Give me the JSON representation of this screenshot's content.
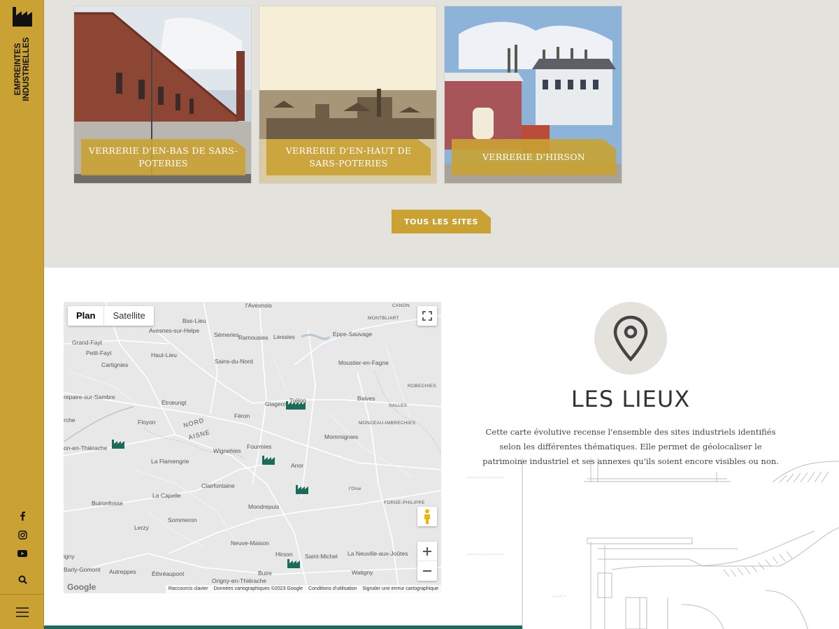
{
  "sidebar": {
    "brand": "EMPREINTES INDUSTRIELLES",
    "social": [
      "facebook-icon",
      "instagram-icon",
      "youtube-icon",
      "search-icon"
    ],
    "menu_icon": "hamburger-icon"
  },
  "cards": [
    {
      "label": "VERRERIE D'EN-BAS DE SARS-POTERIES"
    },
    {
      "label": "VERRERIE D'EN-HAUT DE SARS-POTERIES"
    },
    {
      "label": "VERRERIE D'HIRSON"
    }
  ],
  "all_sites_label": "TOUS LES SITES",
  "map": {
    "tab_plan": "Plan",
    "tab_satellite": "Satellite",
    "footer": {
      "shortcuts": "Raccourcis clavier",
      "data": "Données cartographiques ©2023 Google",
      "terms": "Conditions d'utilisation",
      "report": "Signaler une erreur cartographique"
    },
    "places": [
      "l'Avesnois",
      "CANON",
      "MONTBLIART",
      "Bas-Lieu",
      "Avesnes-sur-Helpe",
      "Sémeries",
      "Ramousies",
      "Liessies",
      "Eppe-Sauvage",
      "Grand-Fayt",
      "Petit-Fayt",
      "Haut-Lieu",
      "Sains-du-Nord",
      "Moustier-en-Fagne",
      "Cartignies",
      "ROBECHIES",
      "repaire-sur-Sambre",
      "Étrœungt",
      "Glageon",
      "Trélon",
      "Baives",
      "SALLES",
      "Féron",
      "MONCEAU-IMBRECHIES",
      "rche",
      "Floyon",
      "NORD",
      "AISNE",
      "Mommignies",
      "on-en-Thiérache",
      "Wignehies",
      "Fourmies",
      "La Flamengrie",
      "Anor",
      "Clairfontaine",
      "La Capelle",
      "l'Oise",
      "FORGE-PHILIPPE",
      "Buironfosse",
      "Mondrepuis",
      "Sommeron",
      "Lerzy",
      "Neuve-Maison",
      "igny",
      "Hirson",
      "Saint-Michel",
      "La Neuville-aux-Joûtes",
      "Barly-Gomont",
      "Autreppes",
      "Éthréaupont",
      "Buire",
      "Watigny",
      "Origny-en-Thiérache"
    ],
    "google_logo": "Google"
  },
  "lieux": {
    "title": "LES LIEUX",
    "description": "Cette carte évolutive recense l'ensemble des sites industriels identifiés selon les différentes thématiques. Elle permet de géolocaliser le patrimoine industriel et ses annexes qu'ils soient encore visibles ou non."
  },
  "colors": {
    "gold": "#c9a233",
    "gray": "#e4e2dd",
    "green": "#1a6b5a"
  }
}
